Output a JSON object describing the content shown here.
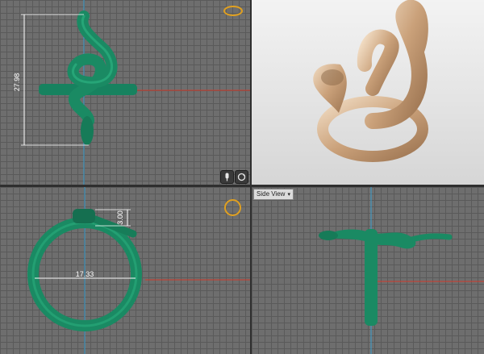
{
  "viewports": {
    "top": {
      "dimension_height": "27.98"
    },
    "perspective": {},
    "front": {
      "dimension_width": "17.33",
      "dimension_thickness": "3.00"
    },
    "side": {
      "view_label": "Side View",
      "view_dropdown_icon": "chevron-down-icon"
    }
  },
  "toolbar_icons": {
    "microphone": "microphone-icon",
    "orbit": "orbit-icon"
  },
  "colors": {
    "grid_bg": "#6e6e6e",
    "model_green": "#1e8f6a",
    "dimension_white": "#ffffff",
    "axis_red": "#d23a2a",
    "axis_blue": "#3aa0d0",
    "ring_badge": "#e0a020",
    "gold": "#d8b48f"
  }
}
